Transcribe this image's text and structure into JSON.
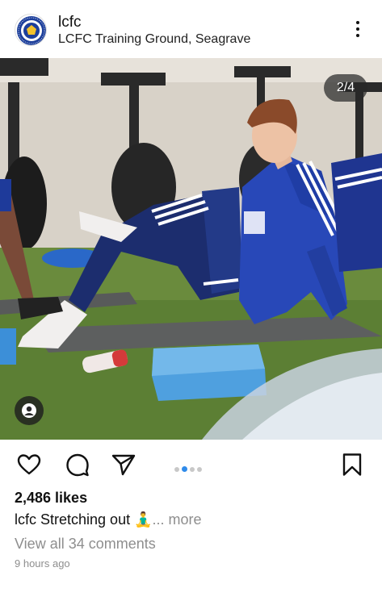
{
  "post": {
    "username": "lcfc",
    "location": "LCFC Training Ground, Seagrave",
    "image_counter": "2/4",
    "likes": "2,486 likes",
    "caption_user": "lcfc",
    "caption_text": "Stretching out 🧘‍♂️",
    "caption_more": "... more",
    "comments_link": "View all 34 comments",
    "timestamp": "9 hours ago",
    "carousel": {
      "total": 4,
      "active_index": 1
    }
  },
  "icons": {
    "avatar": "lcfc-crest-icon",
    "menu": "more-options-icon",
    "tag": "user-tag-icon",
    "like": "heart-icon",
    "comment": "comment-bubble-icon",
    "share": "paper-plane-icon",
    "save": "bookmark-icon"
  },
  "colors": {
    "accent": "#2f8bea",
    "secondary_text": "#8e8e8e",
    "lcfc_blue": "#1d3f9b"
  }
}
